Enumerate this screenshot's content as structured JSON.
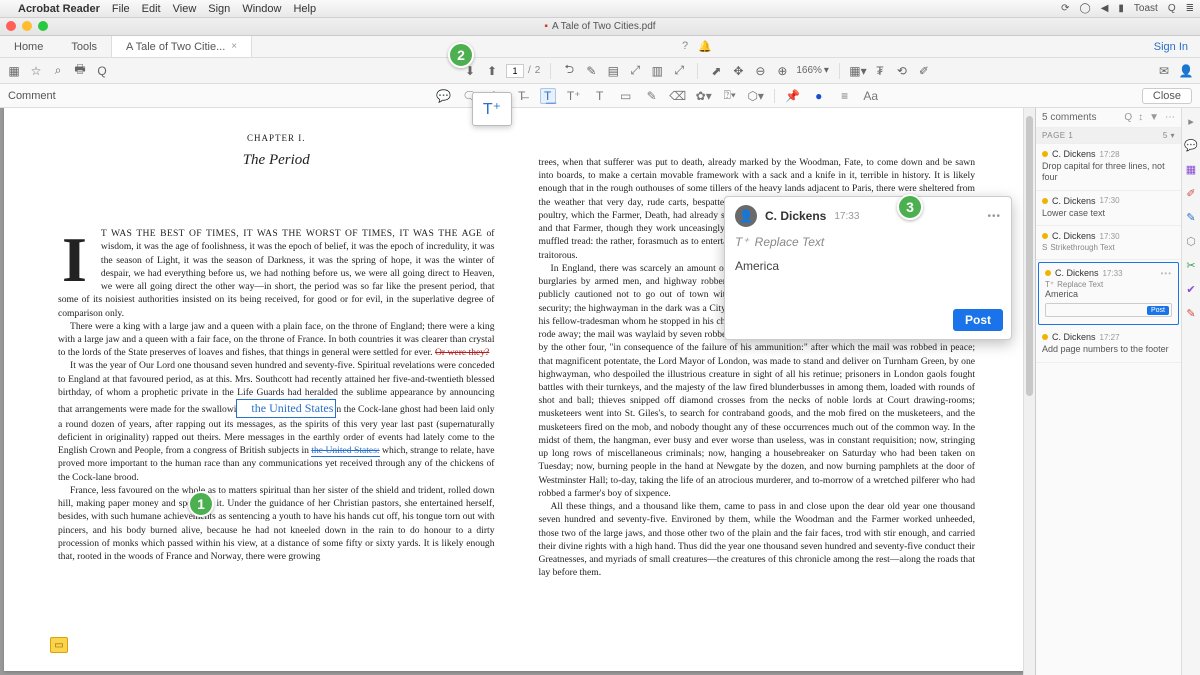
{
  "mac_menu": {
    "apple": "",
    "app": "Acrobat Reader",
    "items": [
      "File",
      "Edit",
      "View",
      "Sign",
      "Window",
      "Help"
    ],
    "right": [
      "⟳",
      "◯",
      "◀",
      "▮",
      "Toast",
      "Q",
      "≣"
    ]
  },
  "window": {
    "title": "A Tale of Two Cities.pdf"
  },
  "top_tabs": {
    "home": "Home",
    "tools": "Tools",
    "doc": "A Tale of Two Citie...",
    "close": "×",
    "icons": [
      "?",
      "🔔",
      "⋯"
    ],
    "signin": "Sign In"
  },
  "toolbar": {
    "left_icons": [
      "▦",
      "☆",
      "⌕",
      "🖶",
      "Q"
    ],
    "nav_icons": [
      "⬇",
      "⬆"
    ],
    "page_current": "1",
    "page_sep": "/",
    "page_total": "2",
    "mid_icons": [
      "⮌",
      "✎",
      "▤",
      "⤢",
      "▥",
      "⤢",
      "⊖",
      "⊕"
    ],
    "cursor": "⬈",
    "view_icons": [
      "✥",
      "⊖",
      "⊕"
    ],
    "zoom": "166%",
    "zoom_caret": "▾",
    "right_icons": [
      "▦▾",
      "₮",
      "⟲",
      "✐"
    ],
    "far_right": [
      "✉",
      "👤"
    ]
  },
  "comment_bar": {
    "label": "Comment",
    "tools": [
      "💬",
      "🗨",
      "✎",
      "T̶",
      "T͟",
      "T⁺",
      "T",
      "▭",
      "✎",
      "⌫",
      "✿▾",
      "⍰▾",
      "⬡▾",
      "📌",
      "●",
      "≡",
      "Aa"
    ],
    "close": "Close"
  },
  "float_tool_icon": "T⁺",
  "badges": {
    "1": "1",
    "2": "2",
    "3": "3"
  },
  "doc": {
    "chapter": "CHAPTER I.",
    "period": "The Period",
    "col1_p1_caps": "T WAS THE BEST OF TIMES, IT WAS THE WORST OF TIMES, IT WAS THE AGE ",
    "col1_p1_rest": "of wisdom, it was the age of foolishness, it was the epoch of belief, it was the epoch of incredulity, it was the season of Light, it was the season of Darkness, it was the spring of hope, it was the winter of despair, we had everything before us, we had nothing before us, we were all going direct to Heaven, we were all going direct the other way—in short, the period was so far like the present period, that some of its noisiest authorities insisted on its being received, for good or for evil, in the superlative degree of comparison only.",
    "col1_p2": "There were a king with a large jaw and a queen with a plain face, on the throne of England; there were a king with a large jaw and a queen with a fair face, on the throne of France. In both countries it was clearer than crystal to the lords of the State preserves of loaves and fishes, that things in general were settled for ever. ",
    "or_were": "Or were they?",
    "col1_p3a": "It was the year of Our Lord one thousand seven hundred and seventy-five. Spiritual revelations were conceded to England at that favoured period, as at this. Mrs. Southcott had recently attained her five-and-twentieth blessed birthday, of whom a prophetic private in the Life Guards had heralded the sublime appearance by announcing that arrangements were made for the swallowi",
    "replace_box": "the United States",
    "col1_p3b": "n the Cock-lane ghost had been laid only a round dozen of years, after rapping out its messages, as the spirits of this very year last past (supernaturally deficient in originality) rapped out theirs. Mere messages in the earthly order of events had lately come to the English Crown and People, from a congress of British subjects in ",
    "replaced_strike": "the United States:",
    "col1_p3c": " which, strange to relate, have proved more important to the human race than any communications yet received through any of the chickens of the Cock-lane brood.",
    "col1_p4": "France, less favoured on the whole as to matters spiritual than her sister of the shield and trident, rolled down hill, making paper money and spending it. Under the guidance of her Christian pastors, she entertained herself, besides, with such humane achievements as sentencing a youth to have his hands cut off, his tongue torn out with pincers, and his body burned alive, because he had not kneeled down in the rain to do honour to a dirty procession of monks which passed within his view, at a distance of some fifty or sixty yards. It is likely enough that, rooted in the woods of France and Norway, there were growing",
    "col2_p1": "trees, when that sufferer was put to death, already marked by the Woodman, Fate, to come down and be sawn into boards, to make a certain movable framework with a sack and a knife in it, terrible in history. It is likely enough that in the rough outhouses of some tillers of the heavy lands adjacent to Paris, there were sheltered from the weather that very day, rude carts, bespattered with rustic mire, snuffed about by pigs, and roosted in by poultry, which the Farmer, Death, had already set apart to be his tumbrils of the Revolution. But that Woodman and that Farmer, though they work unceasingly, work silently, and no one heard them as they went about with muffled tread: the rather, forasmuch as to entertain any suspicion that they were awake, was to be atheistical and traitorous.",
    "col2_p2": "In England, there was scarcely an amount of order and protection to justify much national boasting. Daring burglaries by armed men, and highway robberies, took place in the capital itself every night; families were publicly cautioned not to go out of town without removing their furniture to upholsterers' warehouses for security; the highwayman in the dark was a City tradesman in the light, and, being recognised and challenged by his fellow-tradesman whom he stopped in his character of \"the Captain,\" gallantly shot him through the head and rode away; the mail was waylaid by seven robbers, and the guard shot three dead, and then got shot dead himself by the other four, \"in consequence of the failure of his ammunition:\" after which the mail was robbed in peace; that magnificent potentate, the Lord Mayor of London, was made to stand and deliver on Turnham Green, by one highwayman, who despoiled the illustrious creature in sight of all his retinue; prisoners in London gaols fought battles with their turnkeys, and the majesty of the law fired blunderbusses in among them, loaded with rounds of shot and ball; thieves snipped off diamond crosses from the necks of noble lords at Court drawing-rooms; musketeers went into St. Giles's, to search for contraband goods, and the mob fired on the musketeers, and the musketeers fired on the mob, and nobody thought any of these occurrences much out of the common way. In the midst of them, the hangman, ever busy and ever worse than useless, was in constant requisition; now, stringing up long rows of miscellaneous criminals; now, hanging a housebreaker on Saturday who had been taken on Tuesday; now, burning people in the hand at Newgate by the dozen, and now burning pamphlets at the door of Westminster Hall; to-day, taking the life of an atrocious murderer, and to-morrow of a wretched pilferer who had robbed a farmer's boy of sixpence.",
    "col2_p3": "All these things, and a thousand like them, came to pass in and close upon the dear old year one thousand seven hundred and seventy-five. Environed by them, while the Woodman and the Farmer worked unheeded, those two of the large jaws, and those other two of the plain and the fair faces, trod with stir enough, and carried their divine rights with a high hand. Thus did the year one thousand seven hundred and seventy-five conduct their Greatnesses, and myriads of small creatures—the creatures of this chronicle among the rest—along the roads that lay before them."
  },
  "popup": {
    "avatar": "👤",
    "name": "C. Dickens",
    "time": "17:33",
    "more": "•••",
    "type_icon": "T⁺",
    "type_label": "Replace Text",
    "body": "America",
    "post": "Post"
  },
  "comments": {
    "count": "5 comments",
    "hicons": [
      "Q",
      "↕",
      "▼",
      "⋯"
    ],
    "page_label": "PAGE 1",
    "page_count": "5 ▾",
    "items": [
      {
        "dot": true,
        "name": "C. Dickens",
        "time": "17:28",
        "text": "Drop capital for three lines, not four"
      },
      {
        "dot": true,
        "name": "C. Dickens",
        "time": "17:30",
        "text": "Lower case text"
      },
      {
        "dot": true,
        "name": "C. Dickens",
        "time": "17:30",
        "type_icon": "S",
        "type": "Strikethrough Text"
      },
      {
        "dot": true,
        "name": "C. Dickens",
        "time": "17:33",
        "type_icon": "T⁺",
        "type": "Replace Text",
        "text": "America",
        "active": true,
        "reply": true,
        "post": "Post"
      },
      {
        "dot": true,
        "name": "C. Dickens",
        "time": "17:27",
        "text": "Add page numbers to the footer"
      }
    ]
  },
  "tool_strip": [
    "▸",
    "💬",
    "▦",
    "✐",
    "✎",
    "⬡",
    "✂",
    "✔",
    "✎"
  ]
}
